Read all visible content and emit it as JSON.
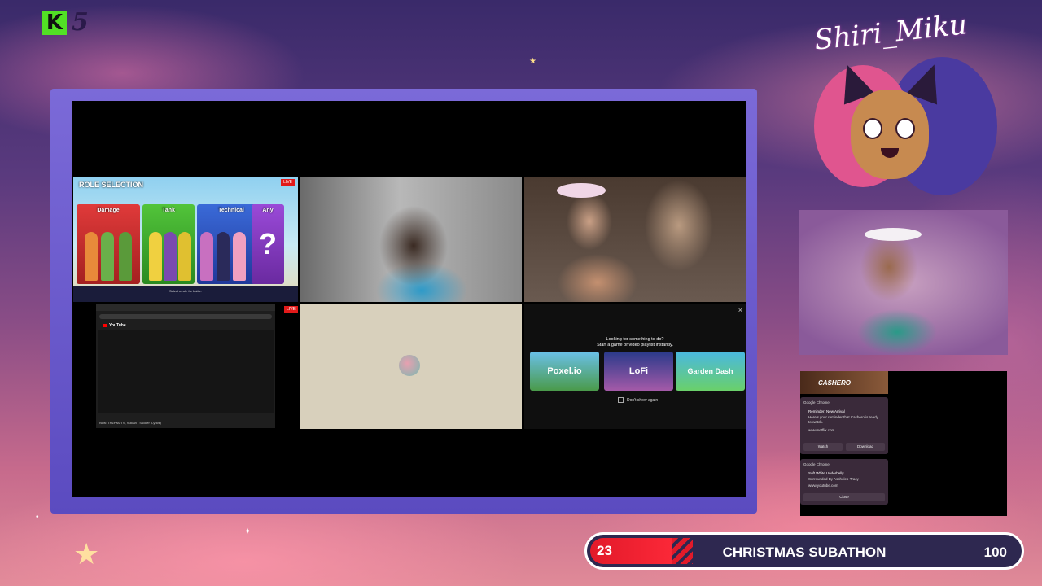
{
  "overlay": {
    "badge_letter": "K",
    "badge_number": "5",
    "logo_text": "Shiri_Miku"
  },
  "role_selection": {
    "title": "ROLE SELECTION",
    "live": "LIVE",
    "cards": [
      "Damage",
      "Tank",
      "Technical",
      "Any"
    ],
    "any_symbol": "?",
    "footer": "Select a role for battle."
  },
  "youtube_tile": {
    "logo": "YouTube",
    "live": "LIVE",
    "now_playing": "Now: TRZPNUTS, Vulcan - Sucker (Lyrics)"
  },
  "suggestions": {
    "message_line1": "Looking for something to do?",
    "message_line2": "Start a game or video playlist instantly.",
    "games": [
      "Poxel.io",
      "LoFi",
      "Garden Dash"
    ],
    "dont_show": "Don't show again",
    "close": "×"
  },
  "notifications": {
    "banner": "CASHERO",
    "items": [
      {
        "source": "Google Chrome",
        "title": "Reminder: New Arrival",
        "body": "Here's your reminder that Cashero is ready to watch.",
        "url": "www.netflix.com",
        "actions": [
          "Watch",
          "Download"
        ]
      },
      {
        "source": "Google Chrome",
        "title": "Soft White Underbelly",
        "body": "Surrounded By Assholes-Tracy",
        "url": "www.youtube.com",
        "actions": [
          "Close"
        ]
      }
    ]
  },
  "subathon": {
    "start_value": "23",
    "label": "CHRISTMAS SUBATHON",
    "end_value": "100",
    "progress_fraction": 0.23,
    "accent_color": "#e21a2a"
  }
}
